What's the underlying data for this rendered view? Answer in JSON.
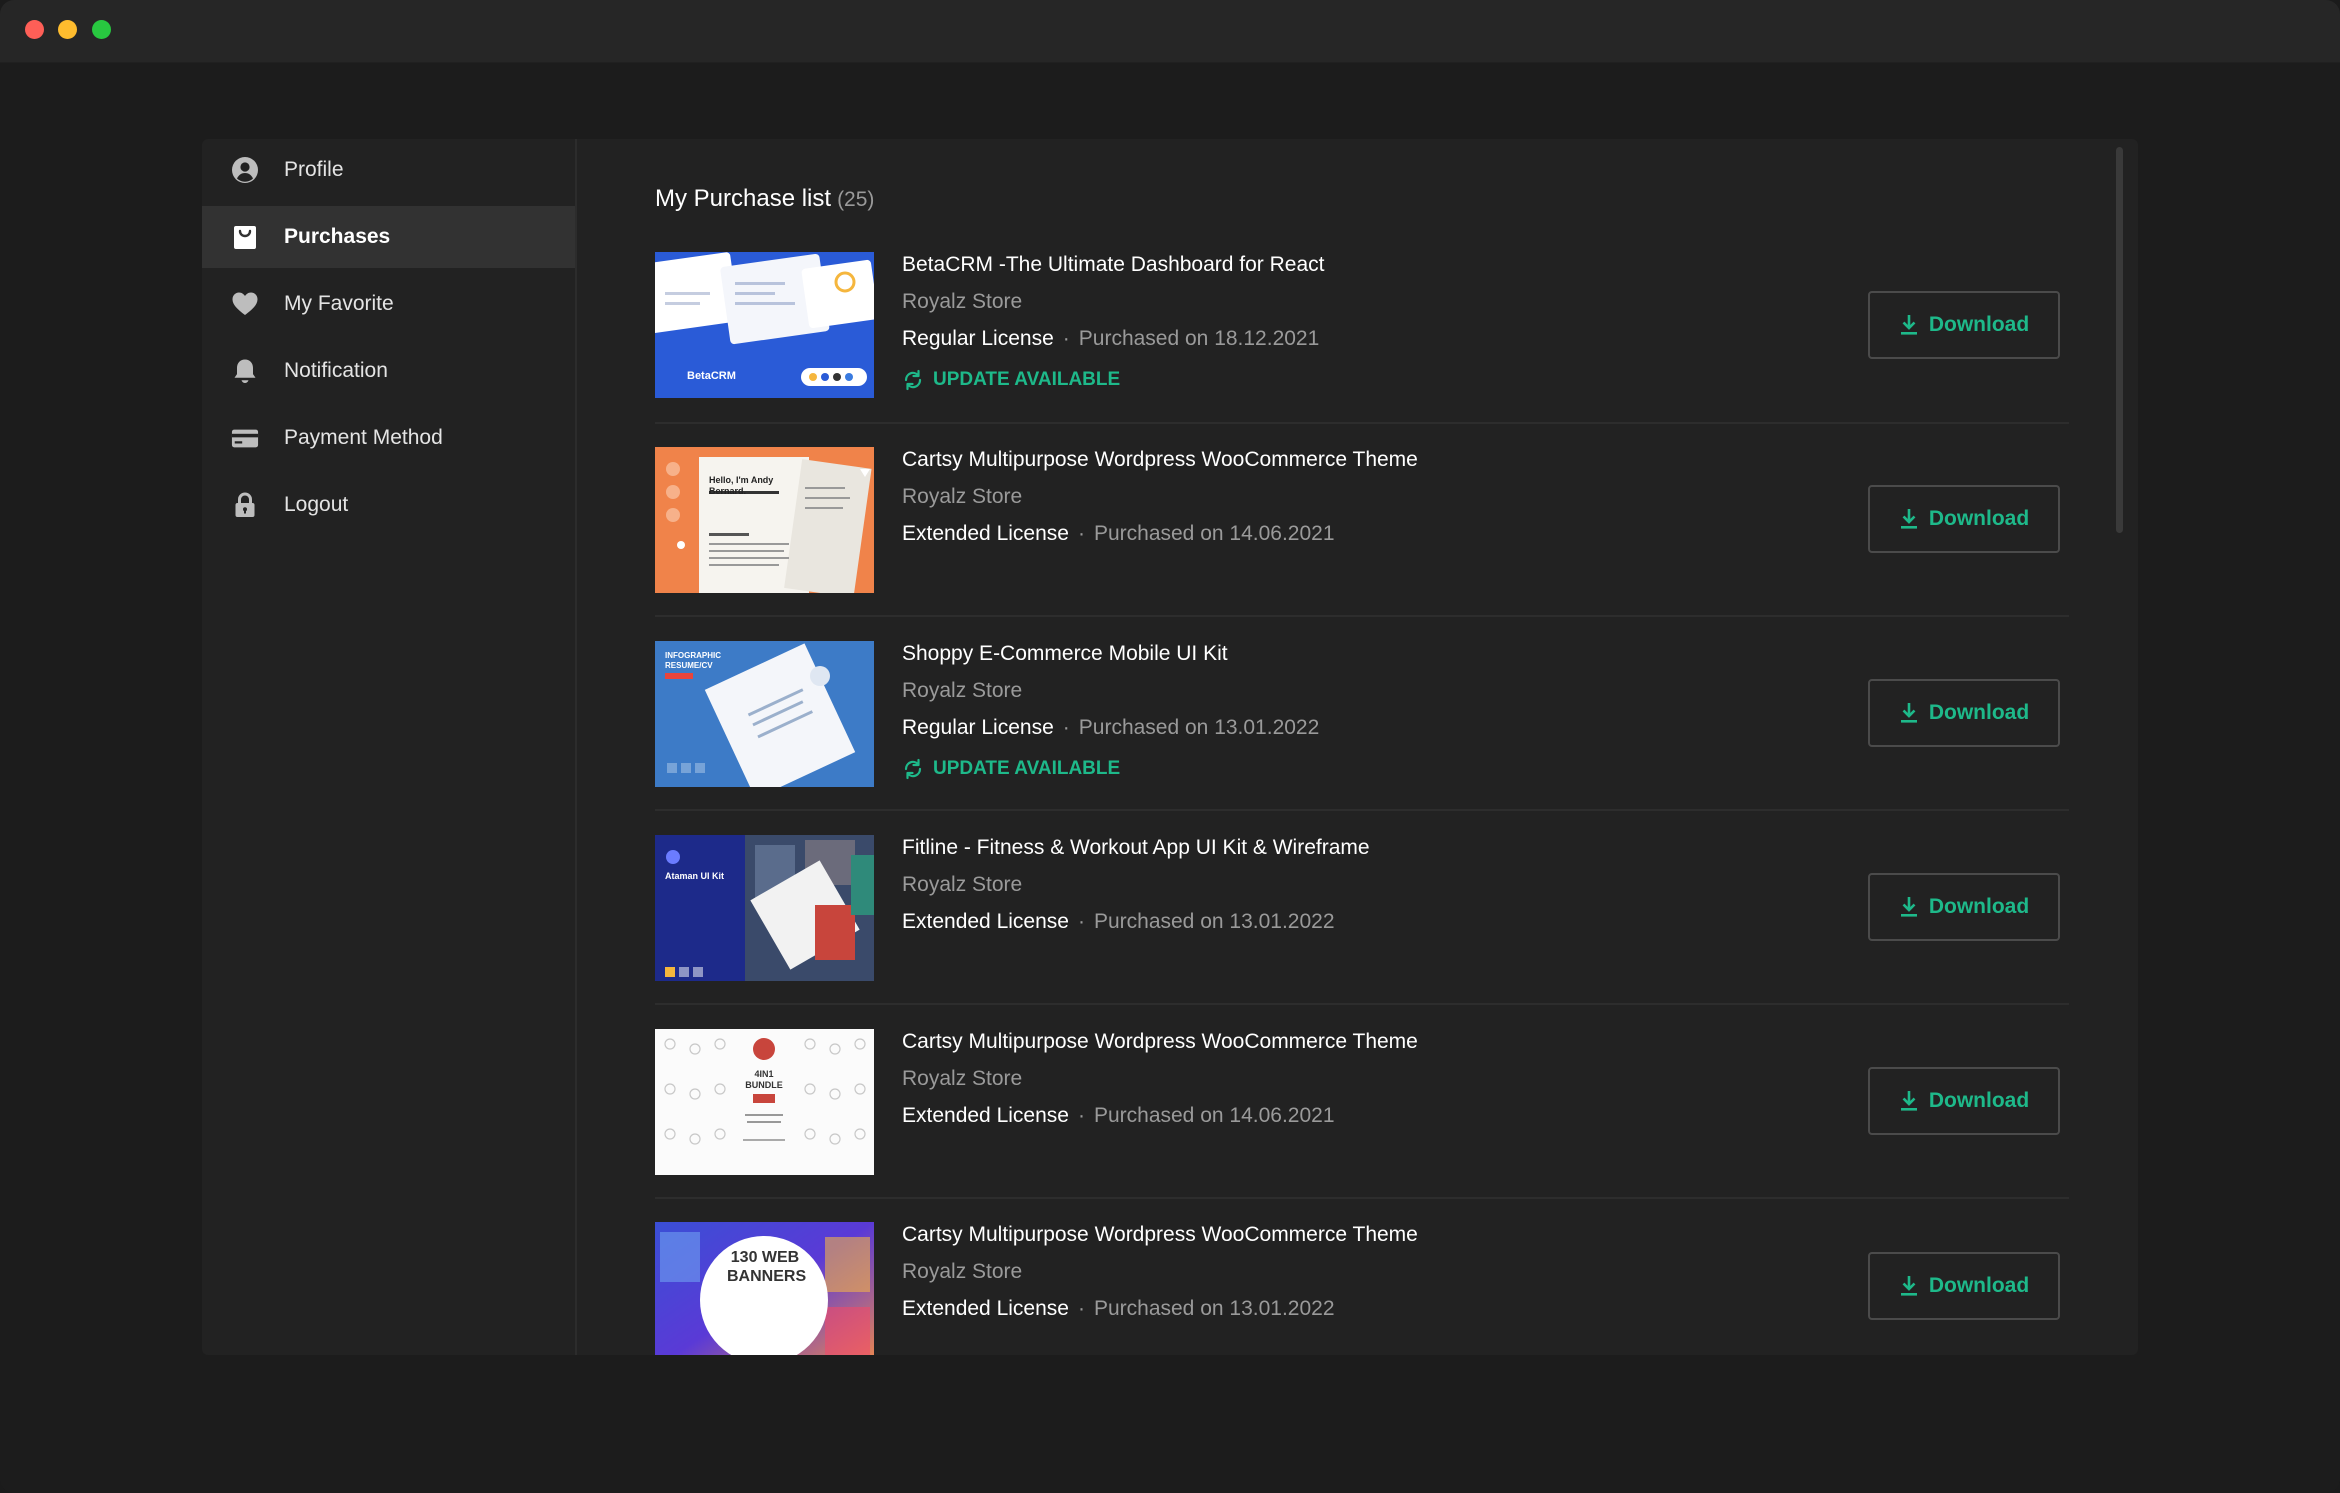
{
  "sidebar": {
    "items": [
      {
        "label": "Profile",
        "icon": "user-circle-icon",
        "active": false
      },
      {
        "label": "Purchases",
        "icon": "shopping-bag-icon",
        "active": true
      },
      {
        "label": "My Favorite",
        "icon": "heart-icon",
        "active": false
      },
      {
        "label": "Notification",
        "icon": "bell-icon",
        "active": false
      },
      {
        "label": "Payment Method",
        "icon": "credit-card-icon",
        "active": false
      },
      {
        "label": "Logout",
        "icon": "lock-icon",
        "active": false
      }
    ]
  },
  "main": {
    "title": "My Purchase list",
    "count": "(25)",
    "download_label": "Download",
    "update_label": "UPDATE AVAILABLE",
    "separator": "·",
    "purchases": [
      {
        "title": "BetaCRM -The Ultimate Dashboard for React",
        "store": "Royalz Store",
        "license": "Regular License",
        "date": "Purchased on 18.12.2021",
        "update": true,
        "thumb_text": "BetaCRM"
      },
      {
        "title": "Cartsy Multipurpose Wordpress WooCommerce Theme",
        "store": "Royalz Store",
        "license": "Extended License",
        "date": "Purchased on 14.06.2021",
        "update": false,
        "thumb_text": "Hello, I'm Andy Bernard."
      },
      {
        "title": "Shoppy E-Commerce Mobile UI Kit",
        "store": "Royalz Store",
        "license": "Regular License",
        "date": "Purchased on 13.01.2022",
        "update": true,
        "thumb_text": "INFOGRAPHIC RESUME/CV"
      },
      {
        "title": "Fitline - Fitness & Workout App UI Kit & Wireframe",
        "store": "Royalz Store",
        "license": "Extended License",
        "date": "Purchased on 13.01.2022",
        "update": false,
        "thumb_text": "Ataman UI Kit"
      },
      {
        "title": "Cartsy Multipurpose Wordpress WooCommerce Theme",
        "store": "Royalz Store",
        "license": "Extended License",
        "date": "Purchased on 14.06.2021",
        "update": false,
        "thumb_text": "4IN1 BUNDLE"
      },
      {
        "title": "Cartsy Multipurpose Wordpress WooCommerce Theme",
        "store": "Royalz Store",
        "license": "Extended License",
        "date": "Purchased on 13.01.2022",
        "update": false,
        "thumb_text": "130 WEB BANNERS"
      }
    ]
  },
  "colors": {
    "accent": "#1eb98a",
    "background": "#1c1c1c",
    "panel": "#222222",
    "active_nav": "#323232"
  }
}
